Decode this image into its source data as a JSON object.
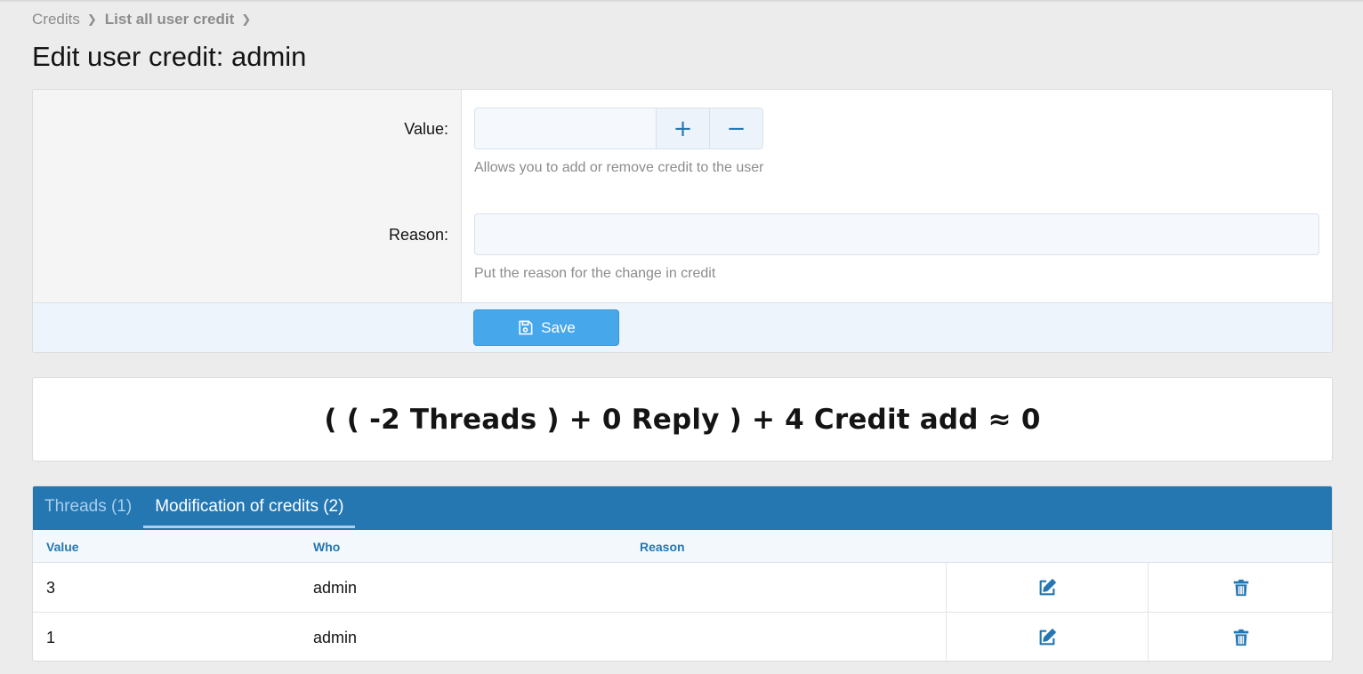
{
  "breadcrumb": [
    {
      "label": "Credits"
    },
    {
      "label": "List all user credit"
    }
  ],
  "page": {
    "title": "Edit user credit: admin"
  },
  "form": {
    "value_label": "Value:",
    "value_input": "",
    "plus_label": "+",
    "minus_label": "−",
    "value_hint": "Allows you to add or remove credit to the user",
    "reason_label": "Reason:",
    "reason_input": "",
    "reason_hint": "Put the reason for the change in credit",
    "save_label": "Save"
  },
  "formula": {
    "text": "( ( -2 Threads ) + 0 Reply ) + 4 Credit add ≈ 0"
  },
  "tabs": [
    {
      "label": "Threads (1)",
      "active": false
    },
    {
      "label": "Modification of credits (2)",
      "active": true
    }
  ],
  "table": {
    "columns": [
      "Value",
      "Who",
      "Reason"
    ],
    "rows": [
      {
        "value": "3",
        "who": "admin",
        "reason": ""
      },
      {
        "value": "1",
        "who": "admin",
        "reason": ""
      }
    ]
  },
  "icons": {
    "save": "save-icon",
    "edit": "edit-icon",
    "delete": "trash-icon"
  },
  "colors": {
    "accent": "#2577b1",
    "save_button": "#47a7eb",
    "background": "#ececec"
  }
}
